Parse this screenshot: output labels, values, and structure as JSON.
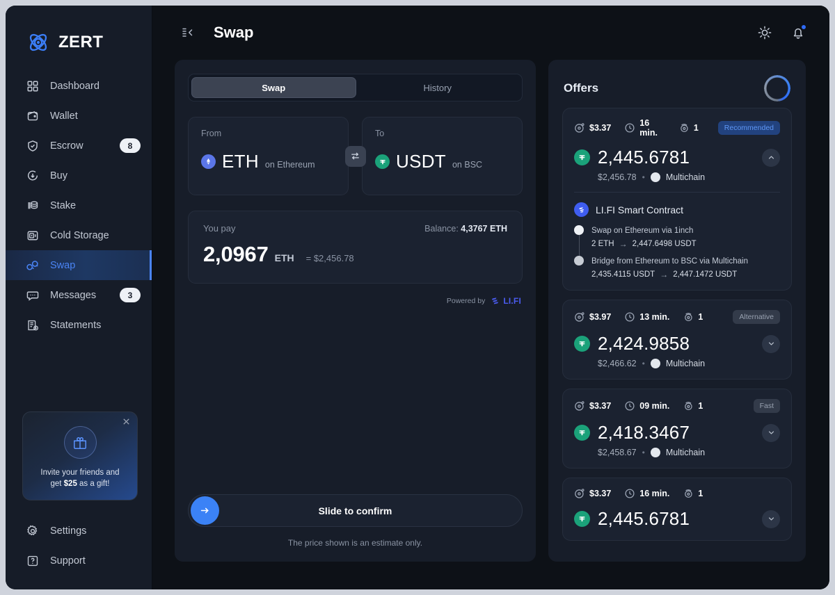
{
  "sidebar": {
    "brand": {
      "name": "ZERT",
      "logo_icon": "atom-logo-icon"
    },
    "items": [
      {
        "label": "Dashboard",
        "icon": "grid-icon",
        "badge": null,
        "active": false
      },
      {
        "label": "Wallet",
        "icon": "wallet-icon",
        "badge": null,
        "active": false
      },
      {
        "label": "Escrow",
        "icon": "shield-check-icon",
        "badge": "8",
        "active": false
      },
      {
        "label": "Buy",
        "icon": "download-circle-icon",
        "badge": null,
        "active": false
      },
      {
        "label": "Stake",
        "icon": "stack-coins-icon",
        "badge": null,
        "active": false
      },
      {
        "label": "Cold Storage",
        "icon": "safe-box-icon",
        "badge": null,
        "active": false
      },
      {
        "label": "Swap",
        "icon": "swap-circles-icon",
        "badge": null,
        "active": true
      },
      {
        "label": "Messages",
        "icon": "chat-bubble-icon",
        "badge": "3",
        "active": false
      },
      {
        "label": "Statements",
        "icon": "document-clock-icon",
        "badge": null,
        "active": false
      }
    ],
    "promo": {
      "icon": "gift-icon",
      "close_icon": "close-icon",
      "line1": "Invite your friends and",
      "line2_pre": "get ",
      "line2_amount": "$25",
      "line2_post": " as a gift!"
    },
    "bottom_items": [
      {
        "label": "Settings",
        "icon": "gear-icon"
      },
      {
        "label": "Support",
        "icon": "question-box-icon"
      }
    ]
  },
  "topbar": {
    "collapse_icon": "collapse-sidebar-icon",
    "title": "Swap",
    "theme_icon": "sun-icon",
    "bell_icon": "bell-icon",
    "has_notification": true
  },
  "swap": {
    "tabs": [
      {
        "label": "Swap",
        "active": true
      },
      {
        "label": "History",
        "active": false
      }
    ],
    "from": {
      "label": "From",
      "symbol": "ETH",
      "chain": "on Ethereum",
      "coin_icon": "ethereum-icon"
    },
    "to": {
      "label": "To",
      "symbol": "USDT",
      "chain": "on BSC",
      "coin_icon": "tether-icon"
    },
    "direction_icon": "swap-direction-icon",
    "pay": {
      "label": "You pay",
      "balance_label": "Balance: ",
      "balance_value": "4,3767 ETH",
      "amount": "2,0967",
      "unit": "ETH",
      "usd": "= $2,456.78"
    },
    "powered": {
      "label": "Powered by",
      "provider": "LI.FI",
      "logo_icon": "lifi-logo-icon"
    },
    "confirm": {
      "text": "Slide to confirm",
      "handle_icon": "arrow-right-icon"
    },
    "note": "The price shown is an estimate only."
  },
  "offers": {
    "title": "Offers",
    "spinner_icon": "loading-spinner-icon",
    "items": [
      {
        "gas": "$3.37",
        "time": "16 min.",
        "steps_count": "1",
        "badge": "Recommended",
        "badge_type": "recommended",
        "amount": "2,445.6781",
        "usd": "$2,456.78",
        "dot": "•",
        "chain": "Multichain",
        "expanded": true,
        "chevron_icon": "chevron-up-icon",
        "route": {
          "title": "LI.FI Smart Contract",
          "logo_icon": "lifi-circle-icon",
          "steps": [
            {
              "title": "Swap on Ethereum via 1inch",
              "from": "2 ETH",
              "arrow": "→",
              "to": "2,447.6498 USDT"
            },
            {
              "title": "Bridge from Ethereum to BSC via Multichain",
              "from": "2,435.4115 USDT",
              "arrow": "→",
              "to": "2,447.1472 USDT"
            }
          ]
        }
      },
      {
        "gas": "$3.97",
        "time": "13 min.",
        "steps_count": "1",
        "badge": "Alternative",
        "badge_type": "alternative",
        "amount": "2,424.9858",
        "usd": "$2,466.62",
        "dot": "•",
        "chain": "Multichain",
        "expanded": false,
        "chevron_icon": "chevron-down-icon"
      },
      {
        "gas": "$3.37",
        "time": "09 min.",
        "steps_count": "1",
        "badge": "Fast",
        "badge_type": "fast",
        "amount": "2,418.3467",
        "usd": "$2,458.67",
        "dot": "•",
        "chain": "Multichain",
        "expanded": false,
        "chevron_icon": "chevron-down-icon"
      },
      {
        "gas": "$3.37",
        "time": "16 min.",
        "steps_count": "1",
        "badge": null,
        "badge_type": null,
        "amount": "2,445.6781",
        "usd": "",
        "dot": "",
        "chain": "",
        "expanded": false,
        "chevron_icon": "chevron-down-icon"
      }
    ]
  },
  "colors": {
    "accent_blue": "#3b82f6",
    "nav_active": "#4a84f5",
    "usdt_green": "#1ba27a",
    "eth_purple": "#5b76e8",
    "lifi_purple": "#4b5cf0",
    "window_bg": "#0d1117",
    "sidebar_bg": "#161c28",
    "card_bg": "#171d29",
    "inner_card_bg": "#1b2230"
  }
}
